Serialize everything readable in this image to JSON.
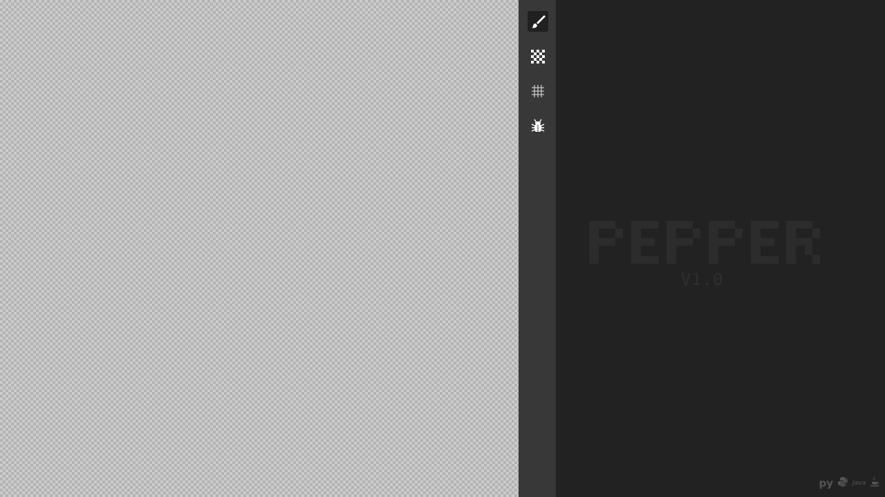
{
  "toolbar": {
    "tools": [
      {
        "icon": "brush-icon",
        "active": true
      },
      {
        "icon": "checkerboard-icon",
        "active": false
      },
      {
        "icon": "grid-icon",
        "active": false
      },
      {
        "icon": "bug-icon",
        "active": false
      }
    ]
  },
  "panel": {
    "app_name": "PEPPER",
    "version": "V1.0",
    "footer": {
      "py_label": "py",
      "java_label": "Java"
    }
  },
  "colors": {
    "canvas_light": "#cccccc",
    "canvas_dark": "#b3b3b3",
    "toolbar_bg": "#383838",
    "panel_bg": "#222222",
    "logo": "#2c2c2c"
  }
}
